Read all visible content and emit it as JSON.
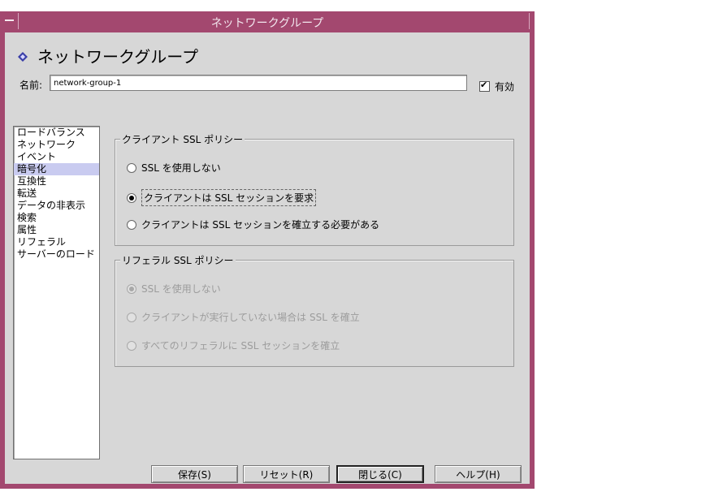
{
  "window": {
    "title": "ネットワークグループ"
  },
  "header": {
    "title": "ネットワークグループ"
  },
  "name": {
    "label": "名前:",
    "value": "network-group-1"
  },
  "enabled": {
    "label": "有効",
    "checked": true
  },
  "nav": {
    "items": [
      {
        "label": "ロードバランス"
      },
      {
        "label": "ネットワーク"
      },
      {
        "label": "イベント"
      },
      {
        "label": "暗号化",
        "selected": true
      },
      {
        "label": "互換性"
      },
      {
        "label": "転送"
      },
      {
        "label": "データの非表示"
      },
      {
        "label": "検索"
      },
      {
        "label": "属性"
      },
      {
        "label": "リフェラル"
      },
      {
        "label": "サーバーのロード"
      }
    ]
  },
  "client_ssl": {
    "legend": "クライアント SSL ポリシー",
    "options": [
      {
        "label": "SSL を使用しない",
        "checked": false
      },
      {
        "label": "クライアントは SSL セッションを要求",
        "checked": true
      },
      {
        "label": "クライアントは SSL セッションを確立する必要がある",
        "checked": false
      }
    ]
  },
  "referral_ssl": {
    "legend": "リフェラル SSL ポリシー",
    "disabled": true,
    "options": [
      {
        "label": "SSL を使用しない",
        "checked": true
      },
      {
        "label": "クライアントが実行していない場合は SSL を確立",
        "checked": false
      },
      {
        "label": "すべてのリフェラルに SSL セッションを確立",
        "checked": false
      }
    ]
  },
  "buttons": {
    "save": "保存(S)",
    "reset": "リセット(R)",
    "close": "閉じる(C)",
    "help": "ヘルプ(H)"
  },
  "colors": {
    "titlebar": "#a3486f",
    "panel": "#d7d7d7",
    "selection": "#c9cbf0"
  },
  "icons": {
    "header": "diamond-icon",
    "window_menu": "window-menu-icon"
  }
}
